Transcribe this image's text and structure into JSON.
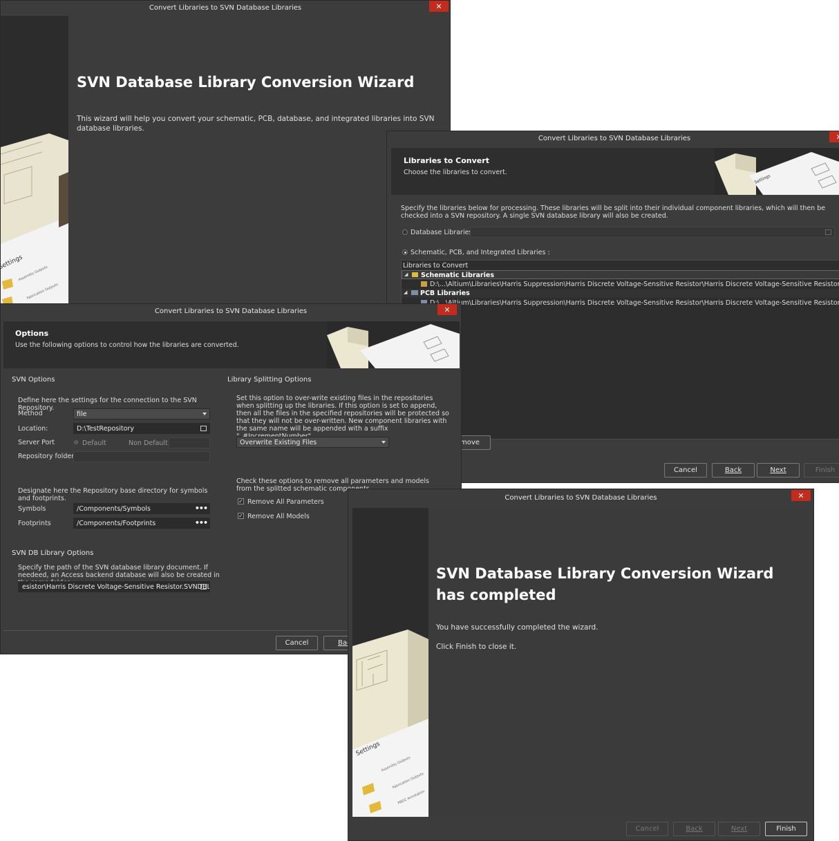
{
  "window_title": "Convert Libraries to SVN Database Libraries",
  "close_glyph": "✕",
  "welcome": {
    "heading": "SVN Database Library Conversion Wizard",
    "description": "This wizard will help you convert your schematic, PCB, database, and integrated libraries into SVN database libraries."
  },
  "art": {
    "settings_label": "Settings",
    "items": [
      "Assembly Outputs",
      "Fabrication Outputs",
      "PBD2 Annotation"
    ]
  },
  "libraries_page": {
    "header_title": "Libraries to Convert",
    "header_subtitle": "Choose the libraries to convert.",
    "intro": "Specify the libraries below for processing. These libraries will be split into their individual component libraries, which will then be checked into a SVN repository. A single SVN database library will also be created.",
    "radio_database": "Database Libraries",
    "radio_schematic": "Schematic, PCB, and Integrated Libraries :",
    "tree_header": "Libraries to Convert",
    "tree": [
      {
        "label": "Schematic Libraries",
        "child": "D:\\...\\Altium\\Libraries\\Harris Suppression\\Harris Discrete Voltage-Sensitive Resistor\\Harris Discrete Voltage-Sensitive Resistor.SchLib"
      },
      {
        "label": "PCB Libraries",
        "child": "D:\\...\\Altium\\Libraries\\Harris Suppression\\Harris Discrete Voltage-Sensitive Resistor\\Harris Discrete Voltage-Sensitive Resistor.PcbLib"
      }
    ],
    "remove_button": "move",
    "buttons": {
      "cancel": "Cancel",
      "back": "Back",
      "next": "Next",
      "finish": "Finish"
    }
  },
  "options_page": {
    "header_title": "Options",
    "header_subtitle": "Use the following options to control how the libraries are converted.",
    "svn_options": {
      "title": "SVN Options",
      "intro": "Define here the settings for the connection to the SVN Repository.",
      "method_label": "Method",
      "method_value": "file",
      "location_label": "Location:",
      "location_value": "D:\\TestRepository",
      "server_port_label": "Server Port",
      "port_default": "Default",
      "port_non_default": "Non Default",
      "repo_folder_label": "Repository folder:",
      "base_dir_intro": "Designate here the Repository base directory for symbols and footprints.",
      "symbols_label": "Symbols",
      "symbols_value": "/Components/Symbols",
      "footprints_label": "Footprints",
      "footprints_value": "/Components/Footprints"
    },
    "db_options": {
      "title": "SVN DB Library Options",
      "intro": "Specify the path of the SVN database library document. If needeed, an Access backend database will also be created in the same folder.",
      "path_value": "esistor\\Harris Discrete Voltage-Sensitive Resistor.SVNDBLib"
    },
    "splitting": {
      "title": "Library Splitting Options",
      "intro": "Set this option to over-write existing files in the repositories when splitting up the libraries. If this option is set to append, then all the files in the specified repositories will be protected so that they will not be over-written. New component libraries with the same name will be appended with a suffix \"_#IncrementNumber\".",
      "mode_value": "Overwrite Existing Files",
      "remove_intro": "Check these options to remove all parameters and models from the splitted schematic components.",
      "remove_params": "Remove All Parameters",
      "remove_models": "Remove All Models"
    },
    "buttons": {
      "cancel": "Cancel",
      "back": "Bac"
    }
  },
  "complete_page": {
    "heading": "SVN Database Library Conversion Wizard has completed",
    "line1": "You have successfully completed the wizard.",
    "line2": "Click Finish to close it.",
    "buttons": {
      "cancel": "Cancel",
      "back": "Back",
      "next": "Next",
      "finish": "Finish"
    }
  },
  "colors": {
    "dialog_bg": "#3c3c3c",
    "close_red": "#c42b1c",
    "field_bg": "#2b2b2b"
  }
}
